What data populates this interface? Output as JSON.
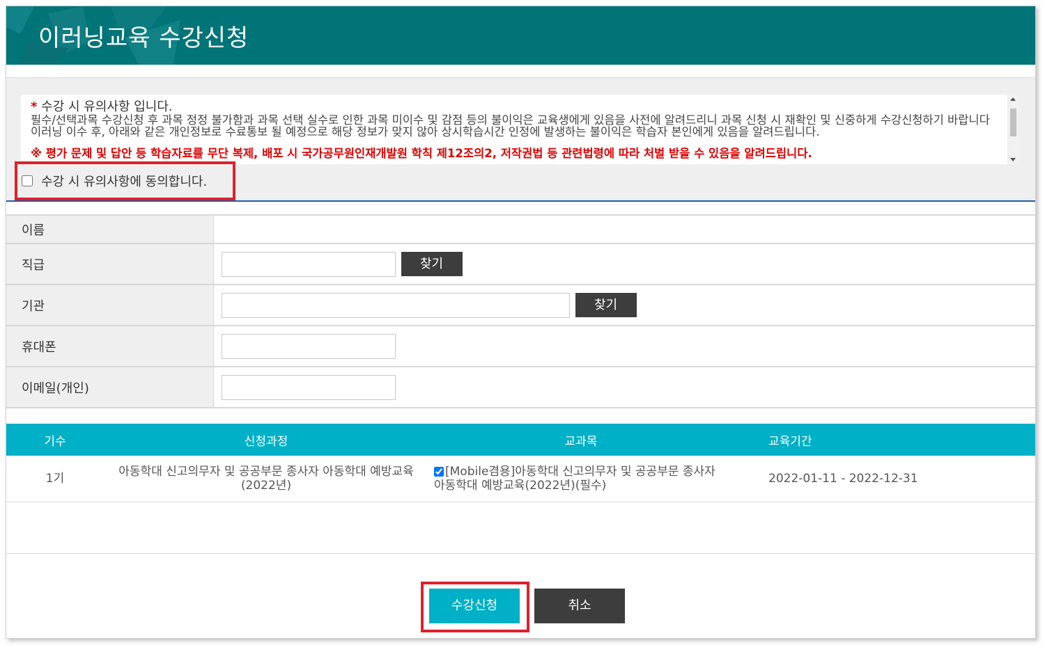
{
  "header": {
    "title": "이러닝교육 수강신청"
  },
  "notice": {
    "title_star": "*",
    "title": "수강 시 유의사항 입니다.",
    "body": "필수/선택과목 수강신청 후 과목 정정 불가함과 과목 선택 실수로 인한 과목 미이수 및 감점 등의 불이익은 교육생에게 있음을 사전에 알려드리니 과목 신청 시 재확인 및 신중하게 수강신청하기 바랍니다 이러닝 이수 후, 아래와 같은 개인정보로 수료통보 될 예정으로 해당 정보가 맞지 않아 상시학습시간 인정에 발생하는 불이익은 학습자 본인에게 있음을 알려드립니다.",
    "warning": "※ 평가 문제 및 답안 등 학습자료를 무단 복제, 배포 시 국가공무원인재개발원 학칙 제12조의2, 저작권법 등 관련법령에 따라 처벌 받을 수 있음을 알려드립니다."
  },
  "agree": {
    "label": "수강 시 유의사항에 동의합니다.",
    "checked": false
  },
  "form": {
    "name_label": "이름",
    "rank_label": "직급",
    "org_label": "기관",
    "phone_label": "휴대폰",
    "email_label": "이메일(개인)",
    "find_label": "찾기",
    "name_value": "",
    "rank_value": "",
    "org_value": "",
    "phone_value": "",
    "email_value": ""
  },
  "courses": {
    "headers": {
      "no": "기수",
      "course": "신청과정",
      "subject": "교과목",
      "period": "교육기간"
    },
    "rows": [
      {
        "no": "1기",
        "course": "아동학대 신고의무자 및 공공부문 종사자 아동학대 예방교육(2022년)",
        "subject": "[Mobile겸용]아동학대 신고의무자 및 공공부문 종사자 아동학대 예방교육(2022년)(필수)",
        "subject_checked": true,
        "period": "2022-01-11 - 2022-12-31"
      }
    ]
  },
  "buttons": {
    "apply": "수강신청",
    "cancel": "취소"
  },
  "colors": {
    "header": "#017478",
    "table_header": "#00b0c6",
    "highlight": "#e0202a",
    "dark_button": "#3d3d3d",
    "warning_text": "#e00000"
  }
}
